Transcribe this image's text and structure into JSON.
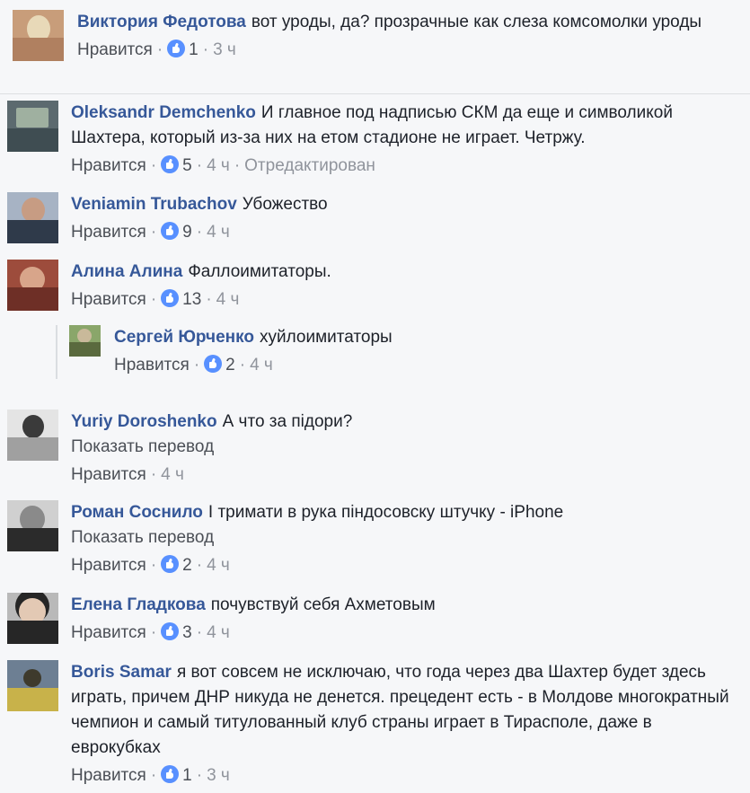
{
  "comments": [
    {
      "author": "Виктория Федотова",
      "text": "вот уроды, да? прозрачные как слеза комсомолки уроды",
      "like_label": "Нравится",
      "likes": "1",
      "time": "3 ч",
      "avatar_colors": [
        "#c89d7a",
        "#e8d9b8",
        "#b08060"
      ]
    },
    {
      "author": "Oleksandr Demchenko",
      "text": "И главное под надписью СКМ да еще и символикой Шахтера, который из-за них на етом стадионе не играет. Четржу.",
      "like_label": "Нравится",
      "likes": "5",
      "time": "4 ч",
      "edited": "Отредактирован",
      "avatar_colors": [
        "#5c6a6f",
        "#9fb0a0",
        "#3f4d52"
      ]
    },
    {
      "author": "Veniamin Trubachov",
      "text": "Убожество",
      "like_label": "Нравится",
      "likes": "9",
      "time": "4 ч",
      "avatar_colors": [
        "#a7b3c4",
        "#2f3a4a",
        "#c79c83"
      ]
    },
    {
      "author": "Алина Алина",
      "text": "Фаллоимитаторы.",
      "like_label": "Нравится",
      "likes": "13",
      "time": "4 ч",
      "avatar_colors": [
        "#9d4c3c",
        "#d8a58a",
        "#6e2f26"
      ]
    },
    {
      "author": "Сергей Юрченко",
      "text": "хуйлоимитаторы",
      "like_label": "Нравится",
      "likes": "2",
      "time": "4 ч",
      "avatar_colors": [
        "#8aa66a",
        "#c9b99a",
        "#5a6a3e"
      ]
    },
    {
      "author": "Yuriy Doroshenko",
      "text": "А что за підори?",
      "translate": "Показать перевод",
      "like_label": "Нравится",
      "time": "4 ч",
      "avatar_colors": [
        "#a0a0a0",
        "#e4e4e4",
        "#3a3a3a"
      ]
    },
    {
      "author": "Роман Соснило",
      "text": "І тримати в рука піндосовску штучку - iPhone",
      "translate": "Показать перевод",
      "like_label": "Нравится",
      "likes": "2",
      "time": "4 ч",
      "avatar_colors": [
        "#d0d0d0",
        "#2b2b2b",
        "#8a8a8a"
      ]
    },
    {
      "author": "Елена Гладкова",
      "text": "почувствуй себя Ахметовым",
      "like_label": "Нравится",
      "likes": "3",
      "time": "4 ч",
      "avatar_colors": [
        "#b9b9b9",
        "#e3c9b4",
        "#262626"
      ]
    },
    {
      "author": "Boris Samar",
      "text": "я вот совсем не исключаю, что года через два Шахтер будет здесь играть, причем ДНР никуда не денется. прецедент есть - в Молдове многократный чемпион и самый титулованный клуб страны играет в Тирасполе, даже в еврокубках",
      "like_label": "Нравится",
      "likes": "1",
      "time": "3 ч",
      "avatar_colors": [
        "#6d7f93",
        "#3e3a2c",
        "#c8b24a"
      ]
    }
  ]
}
